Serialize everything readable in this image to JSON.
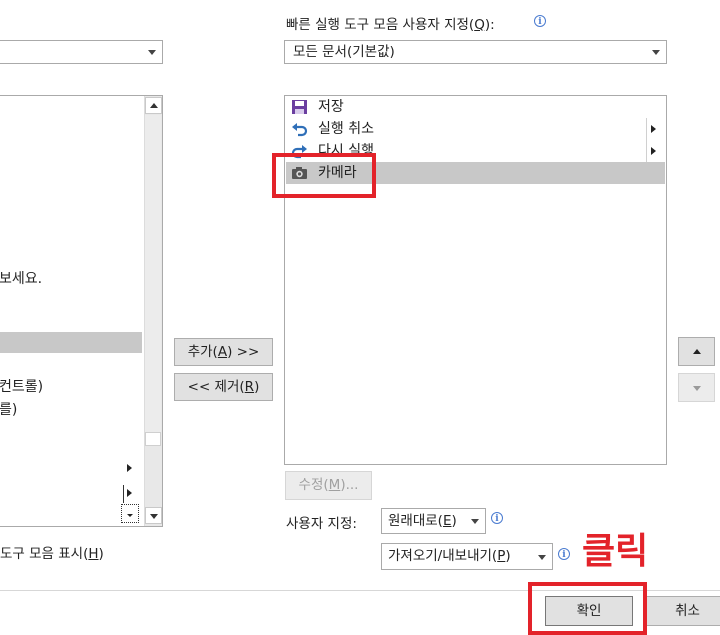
{
  "left_panel": {
    "combo_value": "",
    "list_partial_texts": [
      "보세요.",
      "컨트롤)",
      "를)"
    ],
    "show_below_label": "도구 모음 표시(",
    "show_below_hotkey": "H",
    "show_below_suffix": ")"
  },
  "right_panel": {
    "header_prefix": "빠른 실행 도구 모음 사용자 지정(",
    "header_hotkey": "Q",
    "header_suffix": "):",
    "combo_value": "모든 문서(기본값)",
    "items": [
      {
        "label": "저장",
        "icon": "save-icon",
        "submenu": false,
        "selected": false
      },
      {
        "label": "실행 취소",
        "icon": "undo-icon",
        "submenu": true,
        "selected": false
      },
      {
        "label": "다시 실행",
        "icon": "redo-icon",
        "submenu": true,
        "selected": false
      },
      {
        "label": "카메라",
        "icon": "camera-icon",
        "submenu": false,
        "selected": true
      }
    ],
    "modify_prefix": "수정(",
    "modify_hotkey": "M",
    "modify_suffix": ")...",
    "customize_label": "사용자 지정:",
    "reset_prefix": "원래대로(",
    "reset_hotkey": "E",
    "reset_suffix": ")",
    "import_prefix": "가져오기/내보내기(",
    "import_hotkey": "P",
    "import_suffix": ")"
  },
  "middle_buttons": {
    "add_prefix": "추가(",
    "add_hotkey": "A",
    "add_suffix": ") >>",
    "remove_prefix": "<< 제거(",
    "remove_hotkey": "R",
    "remove_suffix": ")"
  },
  "annotation": {
    "text": "클릭",
    "color": "#e3232a"
  },
  "footer": {
    "ok_label": "확인",
    "cancel_label": "취소"
  },
  "colors": {
    "selection": "#c8c8c8",
    "annotation_red": "#e3232a",
    "save_icon": "#6b3fa0",
    "arrow_icon": "#2f6fb8"
  }
}
